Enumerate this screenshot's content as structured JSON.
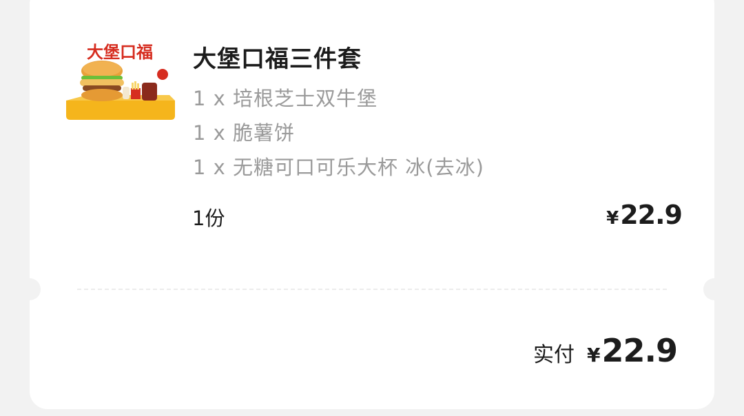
{
  "order": {
    "product": {
      "image_icon": "burger-combo-image",
      "badge_text": "大堡口福",
      "title": "大堡口福三件套",
      "items": [
        "1 x 培根芝士双牛堡",
        "1 x 脆薯饼",
        "1 x 无糖可口可乐大杯 冰(去冰)"
      ],
      "quantity": "1份",
      "currency": "¥",
      "price": "22.9"
    },
    "summary": {
      "label": "实付",
      "currency": "¥",
      "amount": "22.9"
    }
  },
  "colors": {
    "background": "#f2f2f2",
    "card": "#ffffff",
    "title": "#1c1c1c",
    "subtle_text": "#9a9a9a",
    "brand_red": "#d62d20",
    "brand_yellow": "#f5b51c"
  }
}
